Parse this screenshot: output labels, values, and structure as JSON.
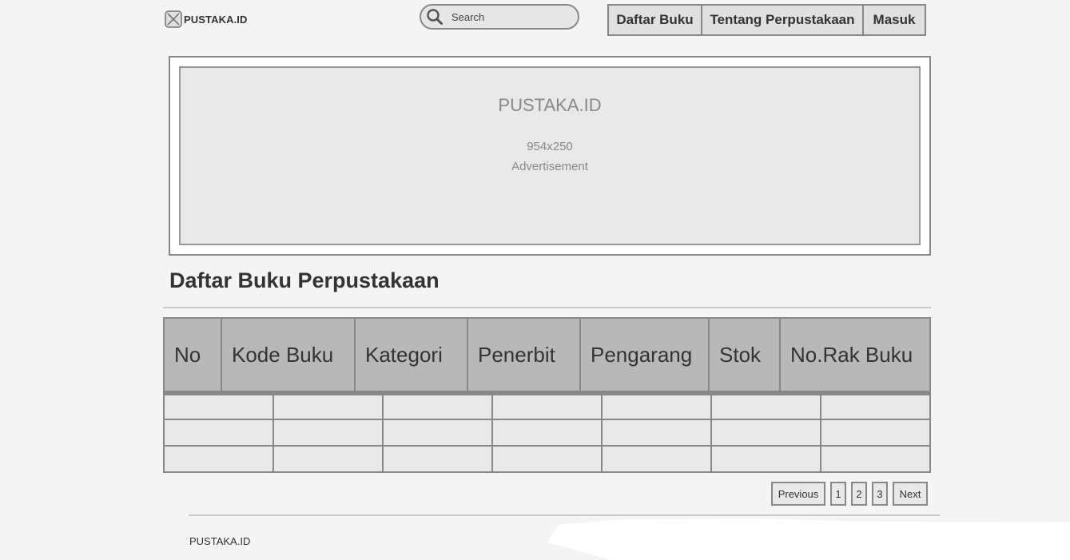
{
  "header": {
    "logo_text": "PUSTAKA.ID",
    "search_placeholder": "Search",
    "nav": [
      {
        "label": "Daftar Buku"
      },
      {
        "label": "Tentang Perpustakaan"
      },
      {
        "label": "Masuk"
      }
    ]
  },
  "ad": {
    "title": "PUSTAKA.ID",
    "size": "954x250",
    "label": "Advertisement"
  },
  "main": {
    "title": "Daftar Buku Perpustakaan",
    "table": {
      "columns": [
        "No",
        "Kode Buku",
        "Kategori",
        "Penerbit",
        "Pengarang",
        "Stok",
        "No.Rak Buku"
      ],
      "rows": [
        [
          "",
          "",
          "",
          "",
          "",
          "",
          ""
        ],
        [
          "",
          "",
          "",
          "",
          "",
          "",
          ""
        ],
        [
          "",
          "",
          "",
          "",
          "",
          "",
          ""
        ]
      ]
    },
    "pagination": {
      "previous": "Previous",
      "pages": [
        "1",
        "2",
        "3"
      ],
      "next": "Next"
    }
  },
  "footer": {
    "text": "PUSTAKA.ID"
  },
  "colors": {
    "background": "#f4f4f4",
    "table_header": "#b8b8b8",
    "cell": "#e8e8e8",
    "border": "#888888"
  }
}
